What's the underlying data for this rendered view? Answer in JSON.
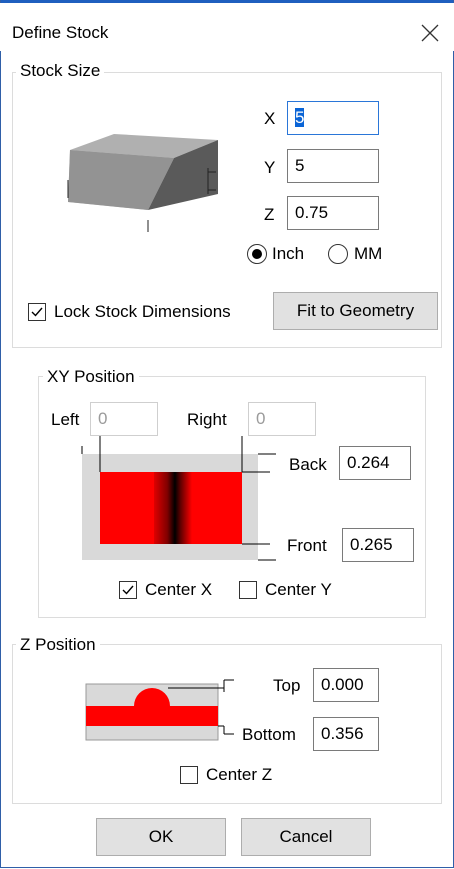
{
  "window": {
    "title": "Define Stock"
  },
  "stock_size": {
    "label": "Stock Size",
    "x_label": "X",
    "x_value": "5",
    "y_label": "Y",
    "y_value": "5",
    "z_label": "Z",
    "z_value": "0.75",
    "unit_inch": "Inch",
    "unit_mm": "MM",
    "selected_unit": "Inch",
    "lock_label": "Lock Stock Dimensions",
    "lock_checked": true,
    "fit_button": "Fit to Geometry"
  },
  "xy_position": {
    "label": "XY Position",
    "left_label": "Left",
    "left_value": "0",
    "right_label": "Right",
    "right_value": "0",
    "back_label": "Back",
    "back_value": "0.264",
    "front_label": "Front",
    "front_value": "0.265",
    "center_x_label": "Center X",
    "center_x_checked": true,
    "center_y_label": "Center Y",
    "center_y_checked": false
  },
  "z_position": {
    "label": "Z Position",
    "top_label": "Top",
    "top_value": "0.000",
    "bottom_label": "Bottom",
    "bottom_value": "0.356",
    "center_z_label": "Center Z",
    "center_z_checked": false
  },
  "footer": {
    "ok": "OK",
    "cancel": "Cancel"
  },
  "colors": {
    "accent": "#0a64d6",
    "stock_red": "#ff0000",
    "stock_gray": "#d9d9d9"
  }
}
